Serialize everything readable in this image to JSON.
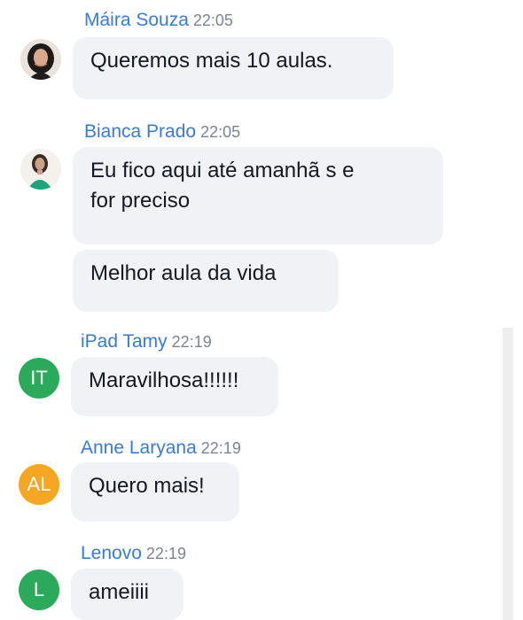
{
  "messages": [
    {
      "author": "Máira Souza",
      "time": "22:05",
      "avatar": {
        "type": "photo",
        "icon": "user-photo-icon"
      },
      "bubbles": [
        "Queremos mais 10 aulas."
      ]
    },
    {
      "author": "Bianca Prado",
      "time": "22:05",
      "avatar": {
        "type": "photo",
        "icon": "user-photo-icon"
      },
      "bubbles": [
        "Eu fico aqui até amanhã s e",
        "for preciso",
        "Melhor aula da vida"
      ]
    },
    {
      "author": "iPad Tamy",
      "time": "22:19",
      "avatar": {
        "type": "initials",
        "initials": "IT",
        "color": "#2aaa5a"
      },
      "bubbles": [
        "Maravilhosa!!!!!!"
      ]
    },
    {
      "author": "Anne Laryana",
      "time": "22:19",
      "avatar": {
        "type": "initials",
        "initials": "AL",
        "color": "#f5a623"
      },
      "bubbles": [
        "Quero mais!"
      ]
    },
    {
      "author": "Lenovo",
      "time": "22:19",
      "avatar": {
        "type": "initials",
        "initials": "L",
        "color": "#2aaa5a"
      },
      "bubbles": [
        "ameiiii"
      ]
    }
  ],
  "colors": {
    "author_name": "#3b7ad1",
    "timestamp": "#7b8591",
    "bubble_bg": "#f1f2f6",
    "message_text": "#141823"
  }
}
